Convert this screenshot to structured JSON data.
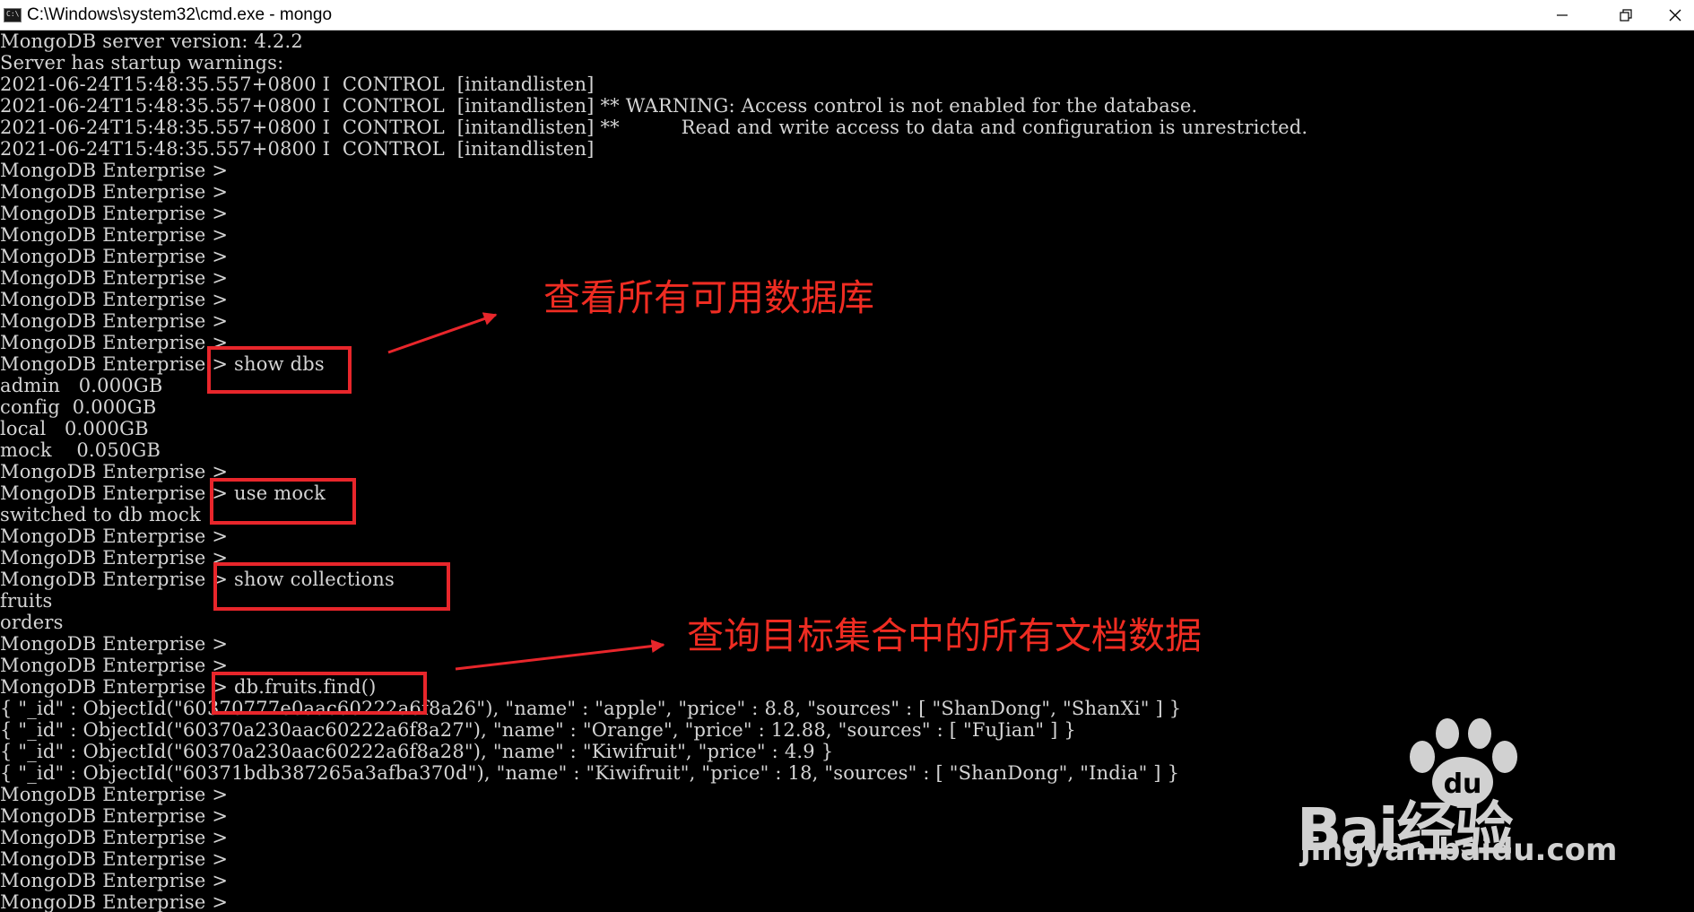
{
  "window": {
    "title": "C:\\Windows\\system32\\cmd.exe - mongo",
    "icon_label": "C:\\",
    "controls": [
      "minimize-icon",
      "restore-icon",
      "close-icon"
    ]
  },
  "console": {
    "lines": [
      "MongoDB server version: 4.2.2",
      "Server has startup warnings:",
      "2021-06-24T15:48:35.557+0800 I  CONTROL  [initandlisten]",
      "2021-06-24T15:48:35.557+0800 I  CONTROL  [initandlisten] ** WARNING: Access control is not enabled for the database.",
      "2021-06-24T15:48:35.557+0800 I  CONTROL  [initandlisten] **          Read and write access to data and configuration is unrestricted.",
      "2021-06-24T15:48:35.557+0800 I  CONTROL  [initandlisten]",
      "MongoDB Enterprise >",
      "MongoDB Enterprise >",
      "MongoDB Enterprise >",
      "MongoDB Enterprise >",
      "MongoDB Enterprise >",
      "MongoDB Enterprise >",
      "MongoDB Enterprise >",
      "MongoDB Enterprise >",
      "MongoDB Enterprise >",
      "MongoDB Enterprise > show dbs",
      "admin   0.000GB",
      "config  0.000GB",
      "local   0.000GB",
      "mock    0.050GB",
      "MongoDB Enterprise >",
      "MongoDB Enterprise > use mock",
      "switched to db mock",
      "MongoDB Enterprise >",
      "MongoDB Enterprise >",
      "MongoDB Enterprise > show collections",
      "fruits",
      "orders",
      "MongoDB Enterprise >",
      "MongoDB Enterprise >",
      "MongoDB Enterprise > db.fruits.find()",
      "{ \"_id\" : ObjectId(\"60370777e0aac60222a6f8a26\"), \"name\" : \"apple\", \"price\" : 8.8, \"sources\" : [ \"ShanDong\", \"ShanXi\" ] }",
      "{ \"_id\" : ObjectId(\"60370a230aac60222a6f8a27\"), \"name\" : \"Orange\", \"price\" : 12.88, \"sources\" : [ \"FuJian\" ] }",
      "{ \"_id\" : ObjectId(\"60370a230aac60222a6f8a28\"), \"name\" : \"Kiwifruit\", \"price\" : 4.9 }",
      "{ \"_id\" : ObjectId(\"60371bdb387265a3afba370d\"), \"name\" : \"Kiwifruit\", \"price\" : 18, \"sources\" : [ \"ShanDong\", \"India\" ] }",
      "MongoDB Enterprise >",
      "MongoDB Enterprise >",
      "MongoDB Enterprise >",
      "MongoDB Enterprise >",
      "MongoDB Enterprise >",
      "MongoDB Enterprise >"
    ]
  },
  "annotations": {
    "show_dbs_note": "查看所有可用数据库",
    "find_note": "查询目标集合中的所有文档数据",
    "color": "#ef2c22"
  },
  "watermark": {
    "brand": "Bai经验",
    "brand_du": "du",
    "url": "jingyan.baidu.com"
  }
}
